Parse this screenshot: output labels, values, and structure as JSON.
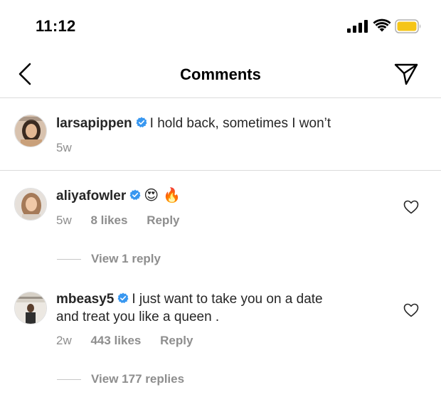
{
  "status_bar": {
    "time": "11:12",
    "battery_color": "#f5c518"
  },
  "header": {
    "title": "Comments"
  },
  "caption": {
    "username": "larsapippen",
    "text": "I hold back, sometimes I won’t",
    "age": "5w",
    "verified": true
  },
  "comments": [
    {
      "username": "aliyafowler",
      "text": "😍 🔥",
      "verified": true,
      "age": "5w",
      "likes": "8 likes",
      "reply_label": "Reply",
      "view_replies": "View 1 reply"
    },
    {
      "username": "mbeasy5",
      "text_line1": "I just want to take you on a date",
      "text_line2": "and treat you like a queen .",
      "verified": true,
      "age": "2w",
      "likes": "443 likes",
      "reply_label": "Reply",
      "view_replies": "View 177 replies"
    }
  ],
  "colors": {
    "verified_blue": "#3897f0",
    "meta_gray": "#8e8e8e",
    "divider": "#dbdbdb"
  },
  "icons": [
    "back-chevron-icon",
    "send-icon",
    "heart-icon",
    "verified-badge-icon",
    "signal-icon",
    "wifi-icon",
    "battery-icon"
  ]
}
